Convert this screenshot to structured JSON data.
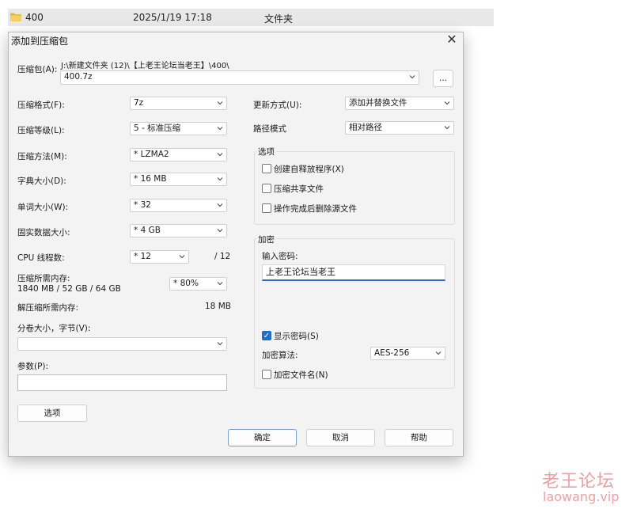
{
  "explorer_row": {
    "name": "400",
    "date": "2025/1/19 17:18",
    "type": "文件夹"
  },
  "dialog": {
    "title": "添加到压缩包",
    "archive_label": "压缩包(A):",
    "archive_path": "J:\\新建文件夹 (12)\\【上老王论坛当老王】\\400\\",
    "archive_name": "400.7z",
    "browse_label": "...",
    "format_label": "压缩格式(F):",
    "format_value": "7z",
    "level_label": "压缩等级(L):",
    "level_value": "5 - 标准压缩",
    "method_label": "压缩方法(M):",
    "method_value": "* LZMA2",
    "dict_label": "字典大小(D):",
    "dict_value": "* 16 MB",
    "word_label": "单词大小(W):",
    "word_value": "* 32",
    "solid_label": "固实数据大小:",
    "solid_value": "* 4 GB",
    "cpu_label": "CPU 线程数:",
    "cpu_value": "* 12",
    "cpu_total": "/ 12",
    "mem_label": "压缩所需内存:",
    "mem_detail": "1840 MB / 52 GB / 64 GB",
    "mem_value": "* 80%",
    "decomp_label": "解压缩所需内存:",
    "decomp_value": "18 MB",
    "split_label": "分卷大小，字节(V):",
    "split_value": "",
    "params_label": "参数(P):",
    "params_value": "",
    "update_label": "更新方式(U):",
    "update_value": "添加并替换文件",
    "pathmode_label": "路径模式",
    "pathmode_value": "相对路径",
    "options_group": "选项",
    "opt_sfx": "创建自释放程序(X)",
    "opt_shared": "压缩共享文件",
    "opt_delete": "操作完成后删除源文件",
    "encrypt_group": "加密",
    "pw_label": "输入密码:",
    "pw_value": "上老王论坛当老王",
    "show_pw": "显示密码(S)",
    "enc_method_label": "加密算法:",
    "enc_method_value": "AES-256",
    "enc_names": "加密文件名(N)",
    "options_button": "选项",
    "ok_button": "确定",
    "cancel_button": "取消",
    "help_button": "帮助"
  },
  "watermark": {
    "line1": "老王论坛",
    "line2": "laowang.vip"
  }
}
